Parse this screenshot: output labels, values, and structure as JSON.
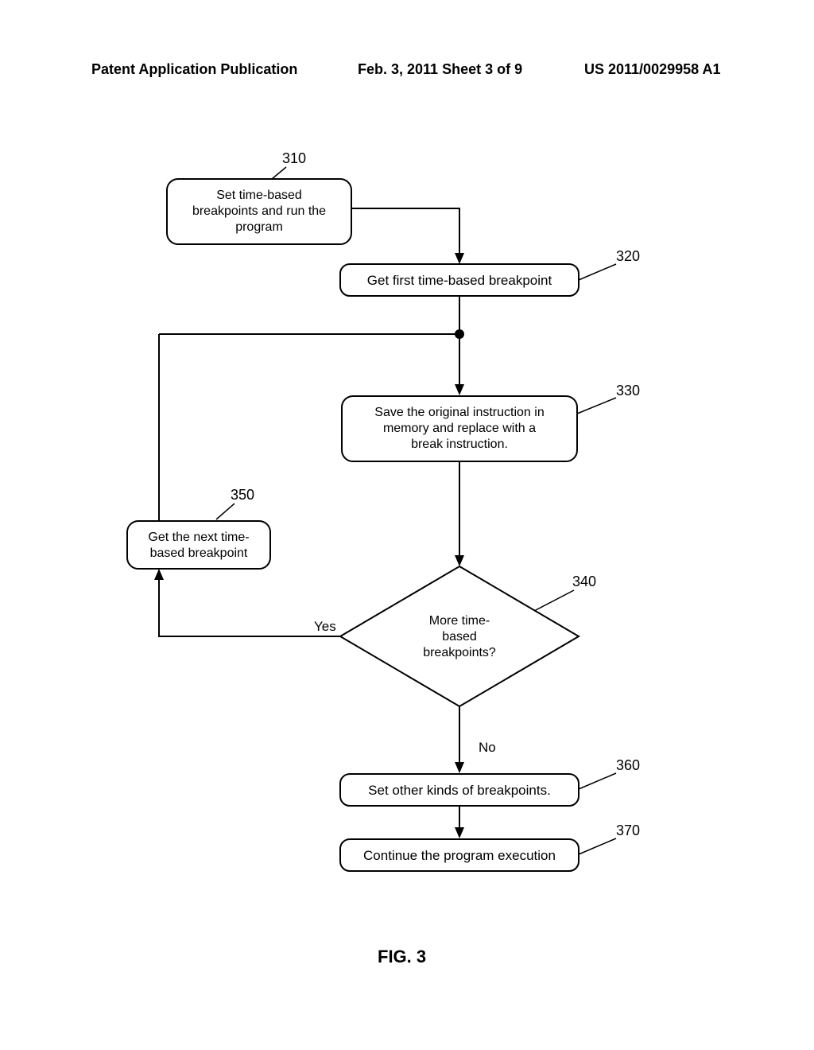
{
  "header": {
    "left": "Patent Application Publication",
    "center": "Feb. 3, 2011  Sheet 3 of 9",
    "right": "US 2011/0029958 A1"
  },
  "figure_caption": "FIG. 3",
  "labels": {
    "n310": "310",
    "n320": "320",
    "n330": "330",
    "n340": "340",
    "n350": "350",
    "n360": "360",
    "n370": "370",
    "yes": "Yes",
    "no": "No"
  },
  "steps": {
    "s310_l1": "Set time-based",
    "s310_l2": "breakpoints and run the",
    "s310_l3": "program",
    "s320": "Get first time-based breakpoint",
    "s330_l1": "Save the original instruction in",
    "s330_l2": "memory and replace with a",
    "s330_l3": "break instruction.",
    "s340_l1": "More time-",
    "s340_l2": "based",
    "s340_l3": "breakpoints?",
    "s350_l1": "Get the next time-",
    "s350_l2": "based breakpoint",
    "s360": "Set other kinds of breakpoints.",
    "s370": "Continue the program execution"
  }
}
